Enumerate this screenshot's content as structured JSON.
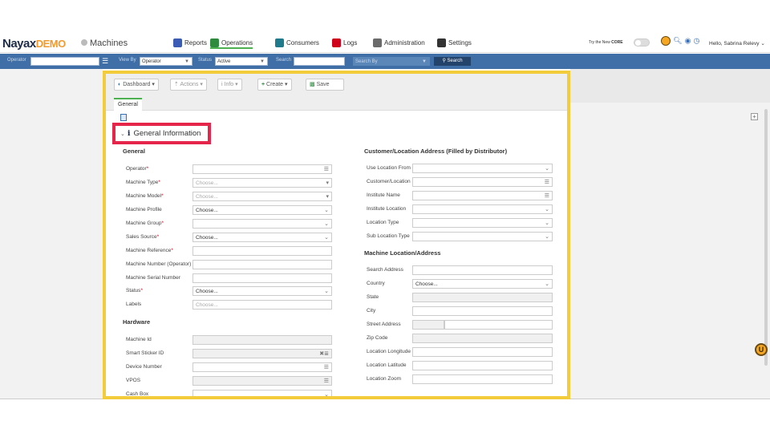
{
  "topnav": {
    "brand_main": "Nayax",
    "brand_demo": "DEMO",
    "crumb": "Machines",
    "items": [
      {
        "label": "Reports",
        "color": "#3b5bb5",
        "icon": "chart-icon"
      },
      {
        "label": "Operations",
        "color": "#2e8b3e",
        "icon": "operations-icon"
      },
      {
        "label": "Consumers",
        "color": "#1f7a8c",
        "icon": "consumers-icon"
      },
      {
        "label": "Logs",
        "color": "#d0021b",
        "icon": "logs-icon"
      },
      {
        "label": "Administration",
        "color": "#6b6b6b",
        "icon": "admin-icon"
      },
      {
        "label": "Settings",
        "color": "#333333",
        "icon": "settings-icon"
      }
    ],
    "try_label": "Try the New",
    "try_core": "CORE",
    "hello": "Hello, Sabrina Relevy"
  },
  "filterbar": {
    "operator_label": "Operator",
    "view_by_label": "View By",
    "view_by_value": "Operator",
    "status_label": "Status",
    "status_value": "Active",
    "search_label": "Search",
    "search_by_placeholder": "Search By",
    "search_button": "Search"
  },
  "toolbar": {
    "dashboard": "Dashboard",
    "actions": "Actions",
    "info": "Info",
    "create": "Create",
    "save": "Save"
  },
  "tabs": {
    "general": "General"
  },
  "section": {
    "title": "General Information"
  },
  "general": {
    "title": "General",
    "rows": [
      {
        "label": "Operator",
        "req": true,
        "value": "",
        "placeholder": "",
        "icon": "list-icon"
      },
      {
        "label": "Machine Type",
        "req": true,
        "value": "",
        "placeholder": "Choose...",
        "icon": "caret-icon"
      },
      {
        "label": "Machine Model",
        "req": true,
        "value": "",
        "placeholder": "Choose...",
        "icon": "caret-icon"
      },
      {
        "label": "Machine Profile",
        "req": false,
        "value": "Choose...",
        "placeholder": "",
        "icon": "chevron-icon"
      },
      {
        "label": "Machine Group",
        "req": true,
        "value": "",
        "placeholder": "",
        "icon": "chevron-icon"
      },
      {
        "label": "Sales Source",
        "req": true,
        "value": "Choose...",
        "placeholder": "",
        "icon": "chevron-icon"
      },
      {
        "label": "Machine Reference",
        "req": true,
        "value": "",
        "placeholder": "",
        "icon": ""
      },
      {
        "label": "Machine Number (Operator)",
        "req": false,
        "value": "",
        "placeholder": "",
        "icon": ""
      },
      {
        "label": "Machine Serial Number",
        "req": false,
        "value": "",
        "placeholder": "",
        "icon": ""
      },
      {
        "label": "Status",
        "req": true,
        "value": "Choose...",
        "placeholder": "",
        "icon": "chevron-icon"
      },
      {
        "label": "Labels",
        "req": false,
        "value": "",
        "placeholder": "Choose...",
        "icon": ""
      }
    ]
  },
  "hardware": {
    "title": "Hardware",
    "rows": [
      {
        "label": "Machine Id",
        "value": "",
        "icon": "",
        "readonly": true
      },
      {
        "label": "Smart Sticker ID",
        "value": "",
        "icon": "clear-barcode-icon",
        "readonly": true
      },
      {
        "label": "Device Number",
        "value": "",
        "icon": "list-icon",
        "readonly": false
      },
      {
        "label": "VPOS",
        "value": "",
        "icon": "list-icon",
        "readonly": true
      },
      {
        "label": "Cash Box",
        "value": "",
        "icon": "chevron-icon",
        "readonly": false
      }
    ]
  },
  "customer": {
    "title": "Customer/Location Address (Filled by Distributor)",
    "rows": [
      {
        "label": "Use Location From",
        "icon": "chevron-icon"
      },
      {
        "label": "Customer/Location",
        "icon": "list-icon"
      },
      {
        "label": "Institute Name",
        "icon": "list-icon"
      },
      {
        "label": "Institute Location",
        "icon": "chevron-icon"
      },
      {
        "label": "Location Type",
        "icon": "chevron-icon"
      },
      {
        "label": "Sub Location Type",
        "icon": "chevron-icon"
      }
    ]
  },
  "machine_location": {
    "title": "Machine Location/Address",
    "rows": [
      {
        "label": "Search Address",
        "value": "",
        "icon": "",
        "readonly": false
      },
      {
        "label": "Country",
        "value": "Choose...",
        "icon": "chevron-icon",
        "readonly": false
      },
      {
        "label": "State",
        "value": "",
        "icon": "",
        "readonly": true
      },
      {
        "label": "City",
        "value": "",
        "icon": "",
        "readonly": false
      },
      {
        "label": "Street Address",
        "value": "",
        "icon": "",
        "readonly": false
      },
      {
        "label": "Zip Code",
        "value": "",
        "icon": "",
        "readonly": true
      },
      {
        "label": "Location Longitude",
        "value": "",
        "icon": "",
        "readonly": false
      },
      {
        "label": "Location Latitude",
        "value": "",
        "icon": "",
        "readonly": false
      },
      {
        "label": "Location Zoom",
        "value": "",
        "icon": "",
        "readonly": false
      }
    ]
  },
  "colors": {
    "highlight_panel": "#f2cc3a",
    "highlight_section": "#e5254a",
    "filterbar": "#3f6fa6",
    "accent": "#4caf50"
  }
}
